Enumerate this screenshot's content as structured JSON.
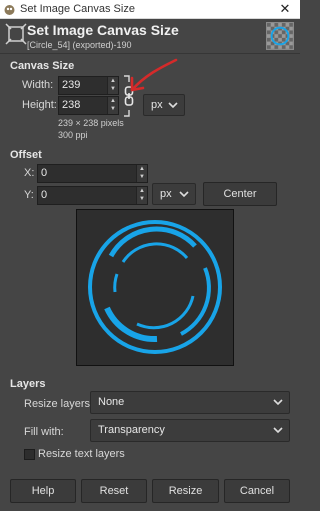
{
  "window": {
    "title": "Set Image Canvas Size",
    "app_icon": "gimp-icon",
    "close_label": "✕"
  },
  "header": {
    "title": "Set Image Canvas Size",
    "subtitle": "[Circle_54] (exported)-190",
    "icon": "canvas-size-icon"
  },
  "canvas_size": {
    "section_title": "Canvas Size",
    "width_label": "Width:",
    "width_value": "239",
    "height_label": "Height:",
    "height_value": "238",
    "unit": "px",
    "info_pixels": "239 × 238 pixels",
    "info_ppi": "300 ppi",
    "chain_linked": true
  },
  "offset": {
    "section_title": "Offset",
    "x_label": "X:",
    "x_value": "0",
    "y_label": "Y:",
    "y_value": "0",
    "unit": "px",
    "center_label": "Center"
  },
  "layers": {
    "section_title": "Layers",
    "resize_layers_label": "Resize layers:",
    "resize_layers_value": "None",
    "fill_with_label": "Fill with:",
    "fill_with_value": "Transparency",
    "resize_text_label": "Resize text layers",
    "resize_text_checked": false
  },
  "buttons": {
    "help": "Help",
    "reset": "Reset",
    "resize": "Resize",
    "cancel": "Cancel"
  },
  "colors": {
    "background": "#454545",
    "preview_circle": "#18a4e8",
    "annotation_arrow": "#d42a2a"
  }
}
